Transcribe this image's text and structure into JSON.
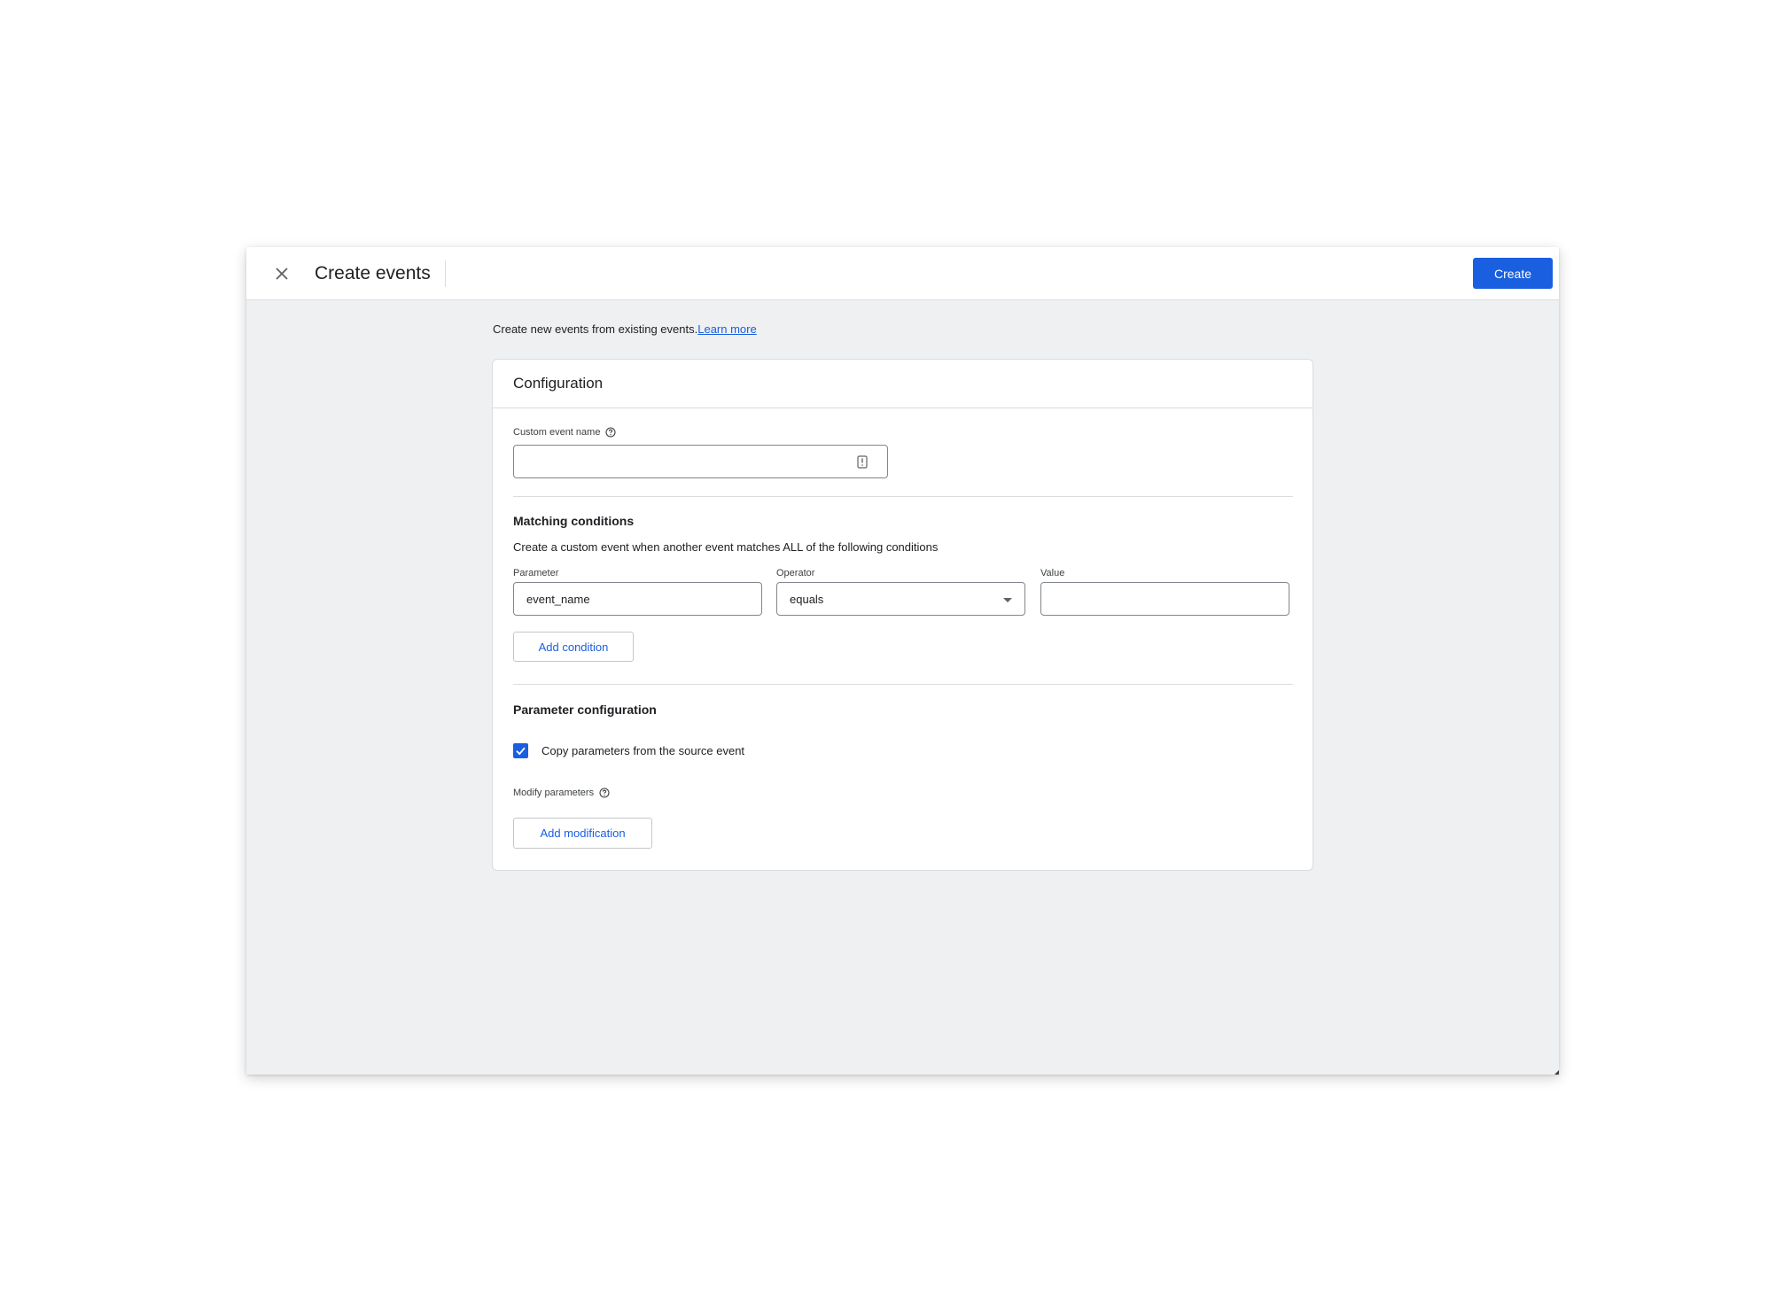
{
  "header": {
    "title": "Create events",
    "create_label": "Create"
  },
  "intro": {
    "text": "Create new events from existing events.",
    "learn_more": "Learn more"
  },
  "configuration": {
    "title": "Configuration",
    "custom_event_name": {
      "label": "Custom event name",
      "value": ""
    },
    "matching_conditions": {
      "title": "Matching conditions",
      "description": "Create a custom event when another event matches ALL of the following conditions",
      "parameter_label": "Parameter",
      "parameter_value": "event_name",
      "operator_label": "Operator",
      "operator_value": "equals",
      "value_label": "Value",
      "value_value": "",
      "add_condition": "Add condition"
    },
    "parameter_configuration": {
      "title": "Parameter configuration",
      "copy_params_label": "Copy parameters from the source event",
      "copy_params_checked": true,
      "modify_params_label": "Modify parameters",
      "add_modification": "Add modification"
    }
  },
  "colors": {
    "accent": "#1a5fe0",
    "background": "#eef0f2",
    "border": "#dadce0"
  },
  "icons": {
    "close": "close-icon",
    "help": "help-circle-icon",
    "field_action": "text-field-action-icon",
    "dropdown": "dropdown-arrow-icon",
    "check": "checkmark-icon"
  }
}
